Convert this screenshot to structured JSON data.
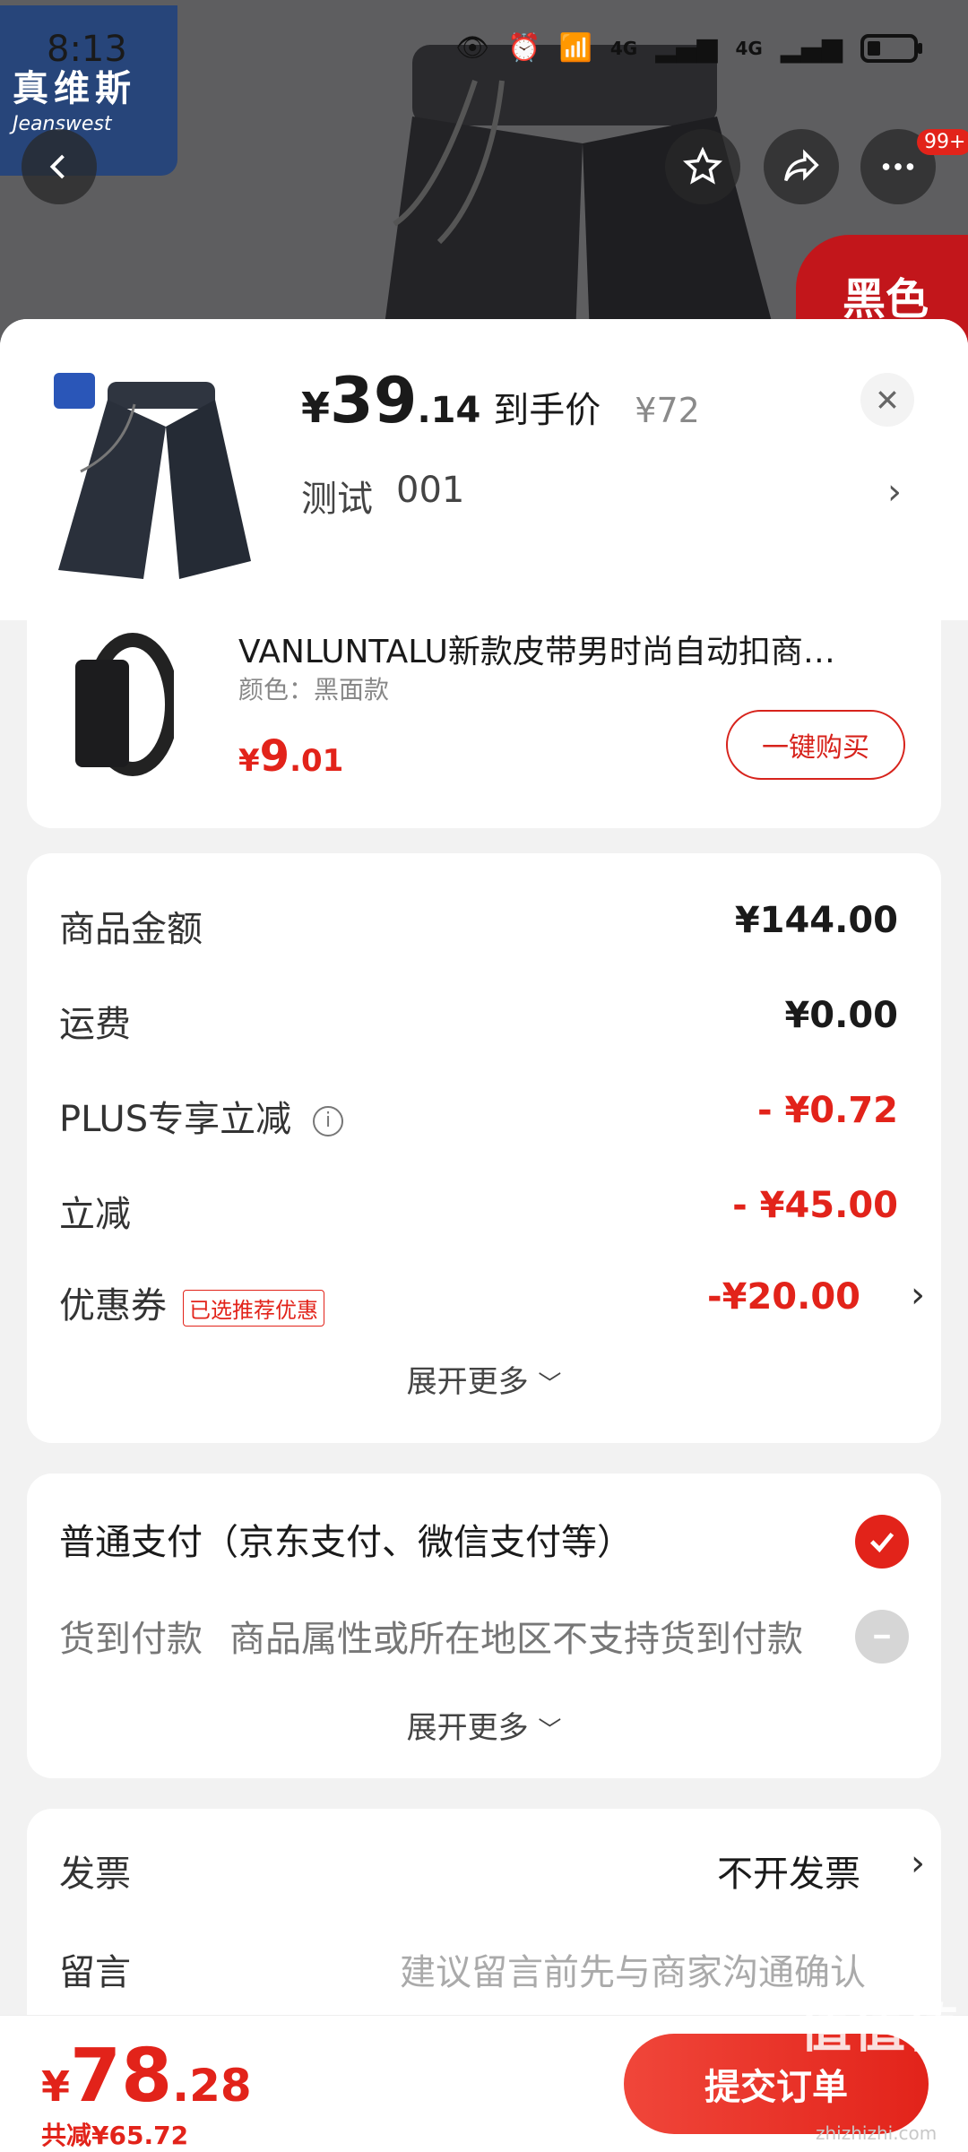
{
  "status_bar": {
    "time": "8:13",
    "network_1": "4G",
    "network_2": "4G"
  },
  "brand": {
    "name_cn": "真维斯",
    "name_en": "Jeanswest"
  },
  "promo_tag": "黑色",
  "top_nav": {
    "notif_badge": "99+"
  },
  "product": {
    "price_yen": "¥",
    "price_int": "39",
    "price_dec": ".14",
    "price_label": "到手价",
    "original_price": "¥72",
    "variant_name": "测试",
    "variant_code": "001"
  },
  "recommended": {
    "title": "VANLUNTALU新款皮带男时尚自动扣商…",
    "attr": "颜色：黑面款",
    "price_yen": "¥",
    "price_int": "9",
    "price_dec": ".01",
    "buy_button": "一键购买"
  },
  "price_details": {
    "rows": [
      {
        "label": "商品金额",
        "value": "¥144.00"
      },
      {
        "label": "运费",
        "value": "¥0.00"
      },
      {
        "label": "PLUS专享立减",
        "value": "- ¥0.72"
      },
      {
        "label": "立减",
        "value": "- ¥45.00"
      },
      {
        "label": "优惠券",
        "tag": "已选推荐优惠",
        "value": "-¥20.00"
      }
    ],
    "expand": "展开更多"
  },
  "payment": {
    "normal": "普通支付（京东支付、微信支付等）",
    "cod_label": "货到付款",
    "cod_desc": "商品属性或所在地区不支持货到付款",
    "expand": "展开更多"
  },
  "invoice": {
    "label": "发票",
    "value": "不开发票"
  },
  "note": {
    "label": "留言",
    "placeholder": "建议留言前先与商家沟通确认"
  },
  "bottom_bar": {
    "total_yen": "¥",
    "total_int": "78",
    "total_dec": ".28",
    "saved": "共减¥65.72",
    "submit": "提交订单"
  },
  "watermark": {
    "main": "值值值",
    "sub": "zhizhizhi.com"
  },
  "colors": {
    "accent": "#e2231a",
    "sheet_bg": "#f2f2f2"
  }
}
